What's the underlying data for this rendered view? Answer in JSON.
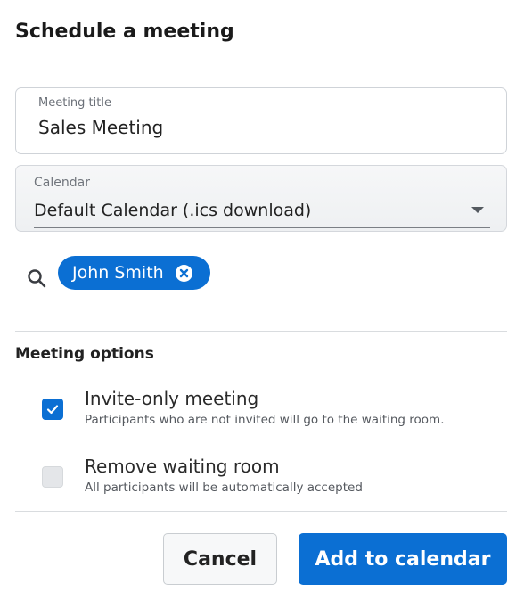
{
  "dialog": {
    "title": "Schedule a meeting"
  },
  "meeting_title": {
    "label": "Meeting title",
    "value": "Sales Meeting"
  },
  "calendar": {
    "label": "Calendar",
    "selected": "Default Calendar (.ics download)"
  },
  "participants": {
    "search_icon": "search-icon",
    "chips": [
      {
        "label": "John Smith",
        "remove_icon": "close-circle-icon"
      }
    ]
  },
  "options": {
    "heading": "Meeting options",
    "items": [
      {
        "title": "Invite-only meeting",
        "description": "Participants who are not invited will go to the waiting room.",
        "checked": true
      },
      {
        "title": "Remove waiting room",
        "description": "All participants will be automatically accepted",
        "checked": false
      }
    ]
  },
  "actions": {
    "cancel_label": "Cancel",
    "submit_label": "Add to calendar"
  },
  "colors": {
    "accent": "#0b6fd3",
    "divider": "#d9dcdf"
  }
}
